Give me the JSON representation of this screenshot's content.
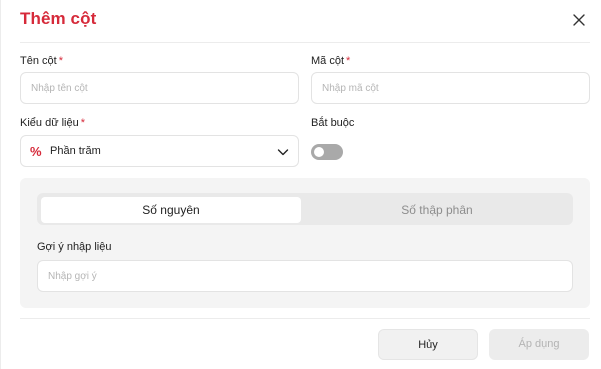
{
  "dialog": {
    "title": "Thêm cột",
    "close_icon": "close-icon"
  },
  "form": {
    "column_name": {
      "label": "Tên cột",
      "required_mark": "*",
      "placeholder": "Nhập tên cột",
      "value": ""
    },
    "column_code": {
      "label": "Mã cột",
      "required_mark": "*",
      "placeholder": "Nhập mã cột",
      "value": ""
    },
    "data_type": {
      "label": "Kiểu dữ liệu",
      "required_mark": "*",
      "icon_glyph": "%",
      "selected": "Phần trăm"
    },
    "required": {
      "label": "Bắt buộc",
      "enabled": false
    }
  },
  "number_format": {
    "tabs": [
      {
        "label": "Số nguyên",
        "active": true
      },
      {
        "label": "Số thập phân",
        "active": false
      }
    ],
    "hint": {
      "label": "Gợi ý nhập liệu",
      "placeholder": "Nhập gợi ý",
      "value": ""
    }
  },
  "footer": {
    "cancel_label": "Hủy",
    "apply_label": "Áp dụng",
    "apply_disabled": true
  },
  "colors": {
    "accent": "#d62a3a",
    "toggle_off": "#a9a9a9",
    "panel_bg": "#f4f4f4"
  }
}
